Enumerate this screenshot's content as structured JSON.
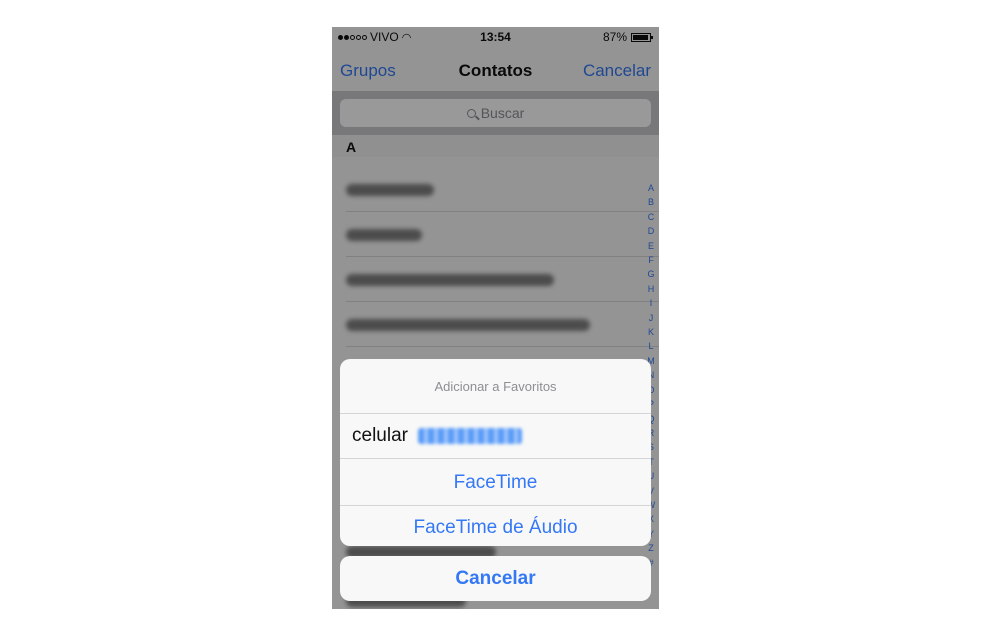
{
  "status_bar": {
    "carrier": "VIVO",
    "time": "13:54",
    "battery": "87%"
  },
  "nav": {
    "left": "Grupos",
    "title": "Contatos",
    "right": "Cancelar"
  },
  "search": {
    "placeholder": "Buscar"
  },
  "list": {
    "section": "A"
  },
  "index_letters": [
    "A",
    "B",
    "C",
    "D",
    "E",
    "F",
    "G",
    "H",
    "I",
    "J",
    "K",
    "L",
    "M",
    "N",
    "O",
    "P",
    "Q",
    "R",
    "S",
    "T",
    "U",
    "V",
    "W",
    "X",
    "Y",
    "Z",
    "#"
  ],
  "action_sheet": {
    "title": "Adicionar a Favoritos",
    "phone_label": "celular",
    "facetime": "FaceTime",
    "facetime_audio": "FaceTime de Áudio",
    "cancel": "Cancelar"
  },
  "colors": {
    "accent": "#3478f6",
    "sheet_bg": "#f8f8f8"
  }
}
